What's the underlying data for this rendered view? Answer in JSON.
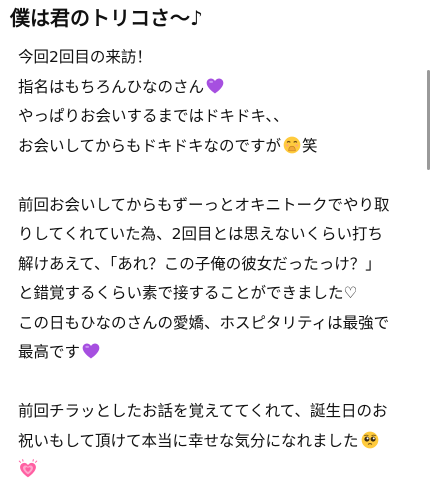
{
  "title": "僕は君のトリコさ〜♪",
  "lines": [
    "今回2回目の来訪！",
    "指名はもちろんひなのさん",
    "やっぱりお会いするまではドキドキ、、",
    "お会いしてからもドキドキなのですが",
    "笑",
    "前回お会いしてからもずーっとオキニトークでやり取",
    "りしてくれていた為、2回目とは思えないくらい打ち",
    "解けあえて、「あれ？この子俺の彼女だったっけ？」",
    "と錯覚するくらい素で接することができました♡",
    "この日もひなのさんの愛嬌、ホスピタリティは最強で",
    "最高です",
    "前回チラッとしたお話を覚えててくれて、誕生日のお",
    "祝いもして頂けて本当に幸せな気分になれました"
  ],
  "icons": {
    "purple_heart": "purple-heart-icon",
    "giggle": "hand-over-mouth-face-icon",
    "pleading": "pleading-face-icon",
    "growing_heart": "growing-heart-icon"
  },
  "colors": {
    "purple_heart": "#a64fe0",
    "emoji_face": "#ffcb3d",
    "pink_heart": "#ff5fa2"
  }
}
